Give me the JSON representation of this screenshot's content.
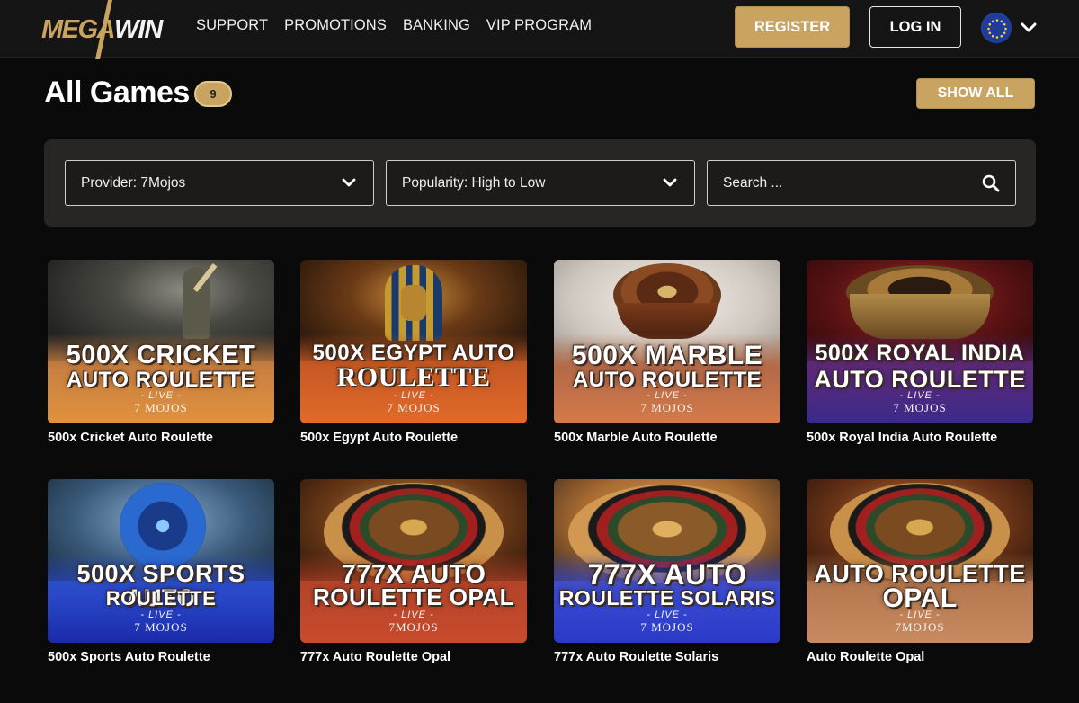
{
  "header": {
    "logo_left": "MEGA",
    "logo_right": "WIN",
    "nav": [
      "SUPPORT",
      "PROMOTIONS",
      "BANKING",
      "VIP PROGRAM"
    ],
    "register_label": "REGISTER",
    "login_label": "LOG IN",
    "language_icon": "eu-flag-icon"
  },
  "main": {
    "title": "All Games",
    "count": "9",
    "show_all_label": "SHOW ALL"
  },
  "filters": {
    "provider": "Provider: 7Mojos",
    "sort": "Popularity: High to Low",
    "search_placeholder": "Search ..."
  },
  "games": [
    {
      "name": "500x Cricket Auto Roulette",
      "line1": "500X CRICKET",
      "line2": "AUTO ROULETTE",
      "live": "- LIVE -",
      "provider": "7 MOJOS"
    },
    {
      "name": "500x Egypt Auto Roulette",
      "line1": "500X EGYPT AUTO",
      "line2": "ROULETTE",
      "live": "- LIVE -",
      "provider": "7 MOJOS"
    },
    {
      "name": "500x Marble Auto Roulette",
      "line1": "500X MARBLE",
      "line2": "AUTO ROULETTE",
      "live": "- LIVE -",
      "provider": "7 MOJOS"
    },
    {
      "name": "500x Royal India Auto Roulette",
      "line1": "500X ROYAL INDIA",
      "line2": "AUTO ROULETTE",
      "live": "- LIVE -",
      "provider": "7 MOJOS"
    },
    {
      "name": "500x Sports Auto Roulette",
      "line1": "500X SPORTS AUTO",
      "line2": "ROULETTE",
      "live": "- LIVE -",
      "provider": "7 MOJOS"
    },
    {
      "name": "777x Auto Roulette Opal",
      "line1": "777X AUTO",
      "line2": "ROULETTE OPAL",
      "live": "- LIVE -",
      "provider": "7MOJOS"
    },
    {
      "name": "777x Auto Roulette Solaris",
      "line1": "777X AUTO",
      "line2": "ROULETTE SOLARIS",
      "live": "- LIVE -",
      "provider": "7 MOJOS"
    },
    {
      "name": "Auto Roulette Opal",
      "line1": "AUTO ROULETTE",
      "line2": "OPAL",
      "live": "- LIVE -",
      "provider": "7MOJOS"
    }
  ],
  "colors": {
    "accent_gold": "#c9a461",
    "page_bg": "#0a0a0a",
    "header_bg": "#151515",
    "panel_bg": "#282624"
  }
}
